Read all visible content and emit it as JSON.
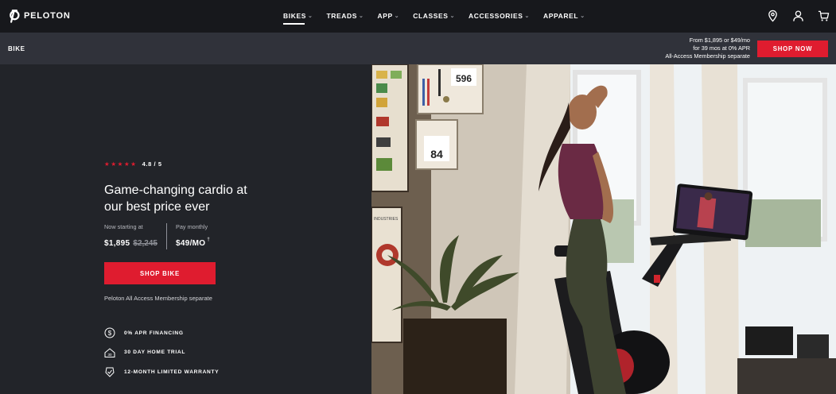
{
  "brand": {
    "name": "PELOTON"
  },
  "nav": {
    "items": [
      {
        "label": "BIKES",
        "active": true
      },
      {
        "label": "TREADS",
        "active": false
      },
      {
        "label": "APP",
        "active": false
      },
      {
        "label": "CLASSES",
        "active": false
      },
      {
        "label": "ACCESSORIES",
        "active": false
      },
      {
        "label": "APPAREL",
        "active": false
      }
    ],
    "icons": [
      "location-pin-icon",
      "account-icon",
      "cart-icon"
    ]
  },
  "subnav": {
    "title": "BIKE",
    "promo_line1": "From $1,895 or $49/mo",
    "promo_line2": "for 39 mos at 0% APR",
    "promo_line3": "All-Access Membership separate",
    "shop_now": "SHOP NOW"
  },
  "hero": {
    "stars": "★★★★★",
    "rating": "4.8 / 5",
    "headline_line1": "Game-changing cardio at",
    "headline_line2": "our best price ever",
    "price_now_label": "Now starting at",
    "price_now": "$1,895",
    "price_old": "$2,245",
    "pay_monthly_label": "Pay monthly",
    "pay_monthly": "$49/MO",
    "pay_monthly_sup": "†",
    "cta": "SHOP BIKE",
    "membership_note": "Peloton All Access Membership separate",
    "features": [
      {
        "icon": "dollar-coin-icon",
        "label": "0% APR FINANCING"
      },
      {
        "icon": "home-30-icon",
        "label": "30 DAY HOME TRIAL"
      },
      {
        "icon": "shield-check-icon",
        "label": "12-MONTH LIMITED WARRANTY"
      }
    ]
  },
  "hero_image": {
    "race_bib_1": "596",
    "race_bib_2": "84",
    "poster_text": "INDUSTRIES"
  },
  "colors": {
    "accent": "#df1c2f",
    "nav_bg": "#17181c",
    "subnav_bg": "#30323a",
    "hero_bg": "#222429"
  }
}
